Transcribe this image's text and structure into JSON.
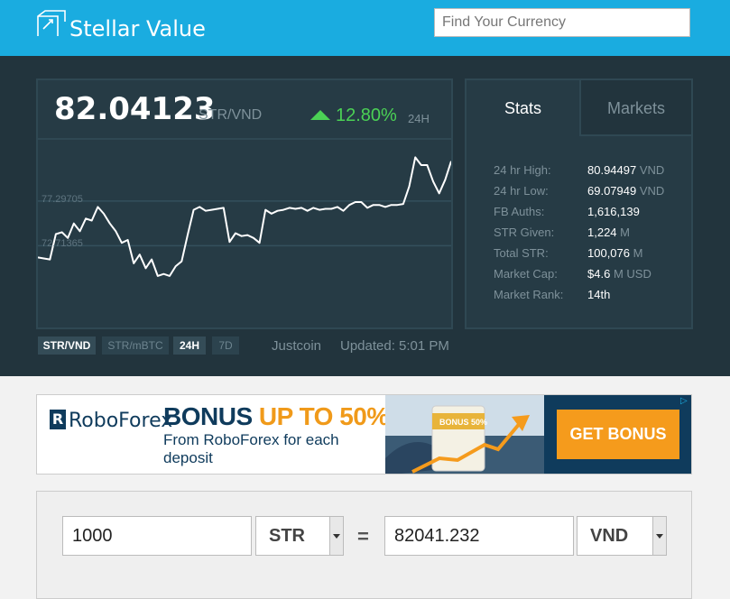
{
  "header": {
    "brand": "Stellar Value",
    "search_placeholder": "Find Your Currency"
  },
  "ticker": {
    "price": "82.04123",
    "pair": "STR/VND",
    "change": "12.80%",
    "period": "24H",
    "colors": {
      "up": "#4bd155",
      "background": "#22343d"
    }
  },
  "chart_data": {
    "type": "line",
    "y_gridlines": [
      77.29705,
      72.71365
    ],
    "grid_label_1": "77.29705",
    "grid_label_2": "72.71365",
    "series": [
      {
        "values": [
          71.5,
          71.4,
          71.3,
          73.9,
          74.1,
          73.5,
          75.0,
          74.2,
          75.5,
          75.3,
          76.7,
          76.0,
          75.0,
          74.2,
          73.0,
          73.3,
          70.9,
          71.8,
          70.4,
          71.3,
          69.6,
          69.8,
          69.6,
          70.6,
          71.1,
          73.8,
          76.4,
          76.7,
          76.3,
          76.4,
          76.5,
          76.6,
          73.1,
          74.0,
          73.7,
          73.8,
          73.5,
          73.0,
          76.4,
          76.0,
          76.3,
          76.4,
          76.6,
          76.5,
          76.6,
          76.3,
          76.6,
          76.4,
          76.5,
          76.5,
          76.7,
          76.3,
          76.9,
          77.2,
          77.2,
          76.6,
          76.9,
          76.9,
          76.7,
          76.9,
          76.9,
          77.0,
          78.8,
          81.8,
          81.0,
          81.0,
          79.3,
          78.1,
          79.5,
          81.4
        ]
      }
    ]
  },
  "chart_controls": {
    "pair_vnd": "STR/VND",
    "pair_mbtc": "STR/mBTC",
    "range_24h": "24H",
    "range_7d": "7D",
    "exchange": "Justcoin",
    "updated": "Updated: 5:01 PM"
  },
  "stats": {
    "tab_stats": "Stats",
    "tab_markets": "Markets",
    "rows": [
      {
        "label": "24 hr High:",
        "value": "80.94497",
        "unit": "VND"
      },
      {
        "label": "24 hr Low:",
        "value": "69.07949",
        "unit": "VND"
      },
      {
        "label": "FB Auths:",
        "value": "1,616,139",
        "unit": ""
      },
      {
        "label": "STR Given:",
        "value": "1,224",
        "unit": "M"
      },
      {
        "label": "Total STR:",
        "value": "100,076",
        "unit": "M"
      },
      {
        "label": "Market Cap:",
        "value": "$4.6",
        "unit": "M USD"
      },
      {
        "label": "Market Rank:",
        "value": "14th",
        "unit": ""
      }
    ]
  },
  "ad": {
    "logo_mark": "R",
    "logo_text": "RoboForex",
    "headline_1": "BONUS",
    "headline_2": "UP TO 50%",
    "subtext": "From RoboForex for each deposit",
    "cup_label": "BONUS 50%",
    "cta": "GET BONUS",
    "colors": {
      "navy": "#0f3b5c",
      "orange": "#f59b1c"
    }
  },
  "converter": {
    "amount": "1000",
    "from_currency": "STR",
    "equals": "=",
    "result": "82041.232",
    "to_currency": "VND"
  }
}
